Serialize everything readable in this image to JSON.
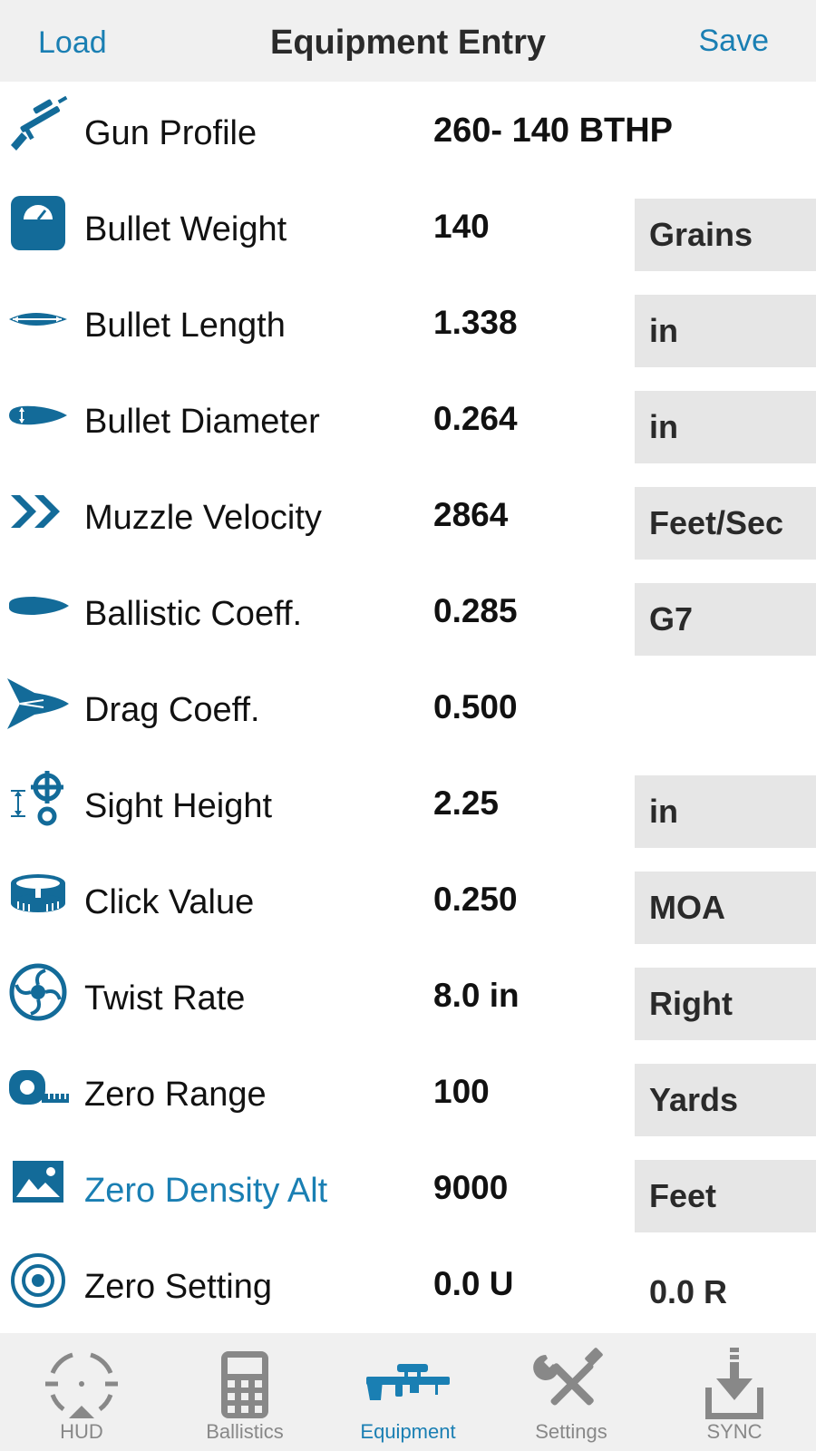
{
  "header": {
    "load_label": "Load",
    "title": "Equipment Entry",
    "save_label": "Save"
  },
  "colors": {
    "accent": "#1a7fb3",
    "icon": "#136b99",
    "inactive": "#888888",
    "unit_bg": "#e6e6e6"
  },
  "rows": [
    {
      "icon": "rifle-icon",
      "label": "Gun Profile",
      "value": "260- 140 BTHP",
      "unit": ""
    },
    {
      "icon": "scale-icon",
      "label": "Bullet Weight",
      "value": "140",
      "unit": "Grains"
    },
    {
      "icon": "bullet-length-icon",
      "label": "Bullet Length",
      "value": "1.338",
      "unit": "in"
    },
    {
      "icon": "bullet-diameter-icon",
      "label": "Bullet Diameter",
      "value": "0.264",
      "unit": "in"
    },
    {
      "icon": "chevrons-right-icon",
      "label": "Muzzle Velocity",
      "value": "2864",
      "unit": "Feet/Sec"
    },
    {
      "icon": "bullet-icon",
      "label": "Ballistic Coeff.",
      "value": "0.285",
      "unit": "G7"
    },
    {
      "icon": "drag-arrow-icon",
      "label": "Drag Coeff.",
      "value": "0.500",
      "unit": ""
    },
    {
      "icon": "sight-height-icon",
      "label": "Sight Height",
      "value": "2.25",
      "unit": "in"
    },
    {
      "icon": "turret-dial-icon",
      "label": "Click Value",
      "value": "0.250",
      "unit": "MOA"
    },
    {
      "icon": "twist-rate-icon",
      "label": "Twist Rate",
      "value": "8.0 in",
      "unit": "Right"
    },
    {
      "icon": "tape-measure-icon",
      "label": "Zero Range",
      "value": "100",
      "unit": "Yards"
    },
    {
      "icon": "landscape-icon",
      "label": "Zero Density Alt",
      "value": "9000",
      "unit": "Feet"
    },
    {
      "icon": "target-icon",
      "label": "Zero Setting",
      "value": "0.0 U",
      "unit": "0.0 R"
    }
  ],
  "tabs": [
    {
      "icon": "reticle-icon",
      "label": "HUD",
      "active": false
    },
    {
      "icon": "calculator-icon",
      "label": "Ballistics",
      "active": false
    },
    {
      "icon": "rifle-icon",
      "label": "Equipment",
      "active": true
    },
    {
      "icon": "wrench-screwdriver-icon",
      "label": "Settings",
      "active": false
    },
    {
      "icon": "download-icon",
      "label": "SYNC",
      "active": false
    }
  ]
}
